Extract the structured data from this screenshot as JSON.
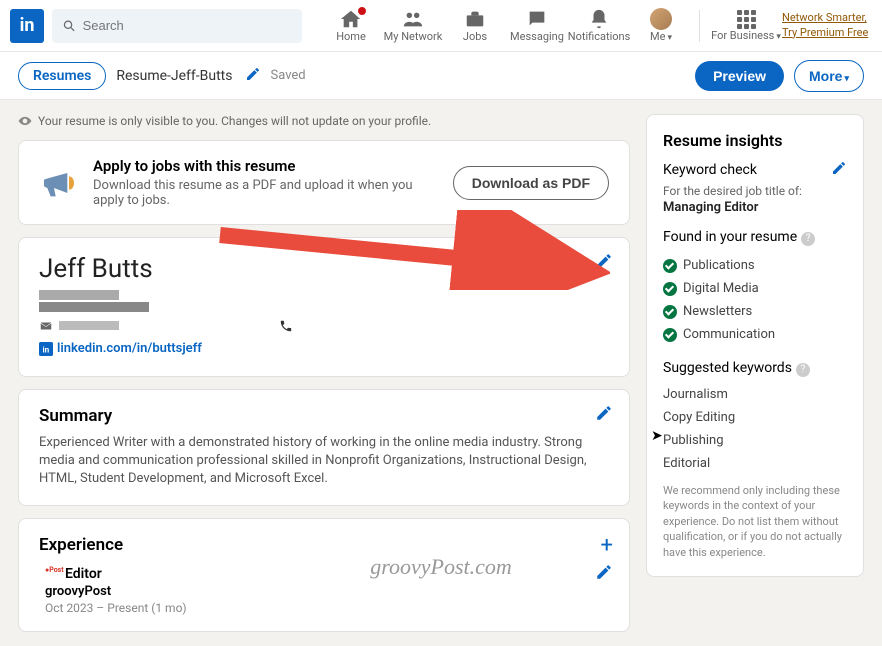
{
  "nav": {
    "search_placeholder": "Search",
    "items": [
      {
        "label": "Home"
      },
      {
        "label": "My Network"
      },
      {
        "label": "Jobs"
      },
      {
        "label": "Messaging"
      },
      {
        "label": "Notifications"
      },
      {
        "label": "Me"
      }
    ],
    "business_label": "For Business",
    "premium_line1": "Network Smarter,",
    "premium_line2": "Try Premium Free"
  },
  "toolbar": {
    "resumes_label": "Resumes",
    "doc_title": "Resume-Jeff-Butts",
    "saved_label": "Saved",
    "preview_label": "Preview",
    "more_label": "More"
  },
  "notice": "Your resume is only visible to you. Changes will not update on your profile.",
  "apply": {
    "title": "Apply to jobs with this resume",
    "desc": "Download this resume as a PDF and upload it when you apply to jobs.",
    "button": "Download as PDF"
  },
  "resume": {
    "name": "Jeff Butts",
    "url": "linkedin.com/in/buttsjeff"
  },
  "summary": {
    "heading": "Summary",
    "text": "Experienced Writer with a demonstrated history of working in the online media industry. Strong media and communication professional skilled in Nonprofit Organizations, Instructional Design, HTML, Student Development, and Microsoft Excel."
  },
  "experience": {
    "heading": "Experience",
    "job_title": "Editor",
    "company": "groovyPost",
    "dates": "Oct 2023 – Present (1 mo)"
  },
  "insights": {
    "heading": "Resume insights",
    "keyword_check": "Keyword check",
    "desc": "For the desired job title of:",
    "job_title": "Managing Editor",
    "found_heading": "Found in your resume",
    "found": [
      "Publications",
      "Digital Media",
      "Newsletters",
      "Communication"
    ],
    "suggested_heading": "Suggested keywords",
    "suggested": [
      "Journalism",
      "Copy Editing",
      "Publishing",
      "Editorial"
    ],
    "note": "We recommend only including these keywords in the context of your experience. Do not list them without qualification, or if you do not actually have this experience."
  },
  "watermark": "groovyPost.com"
}
